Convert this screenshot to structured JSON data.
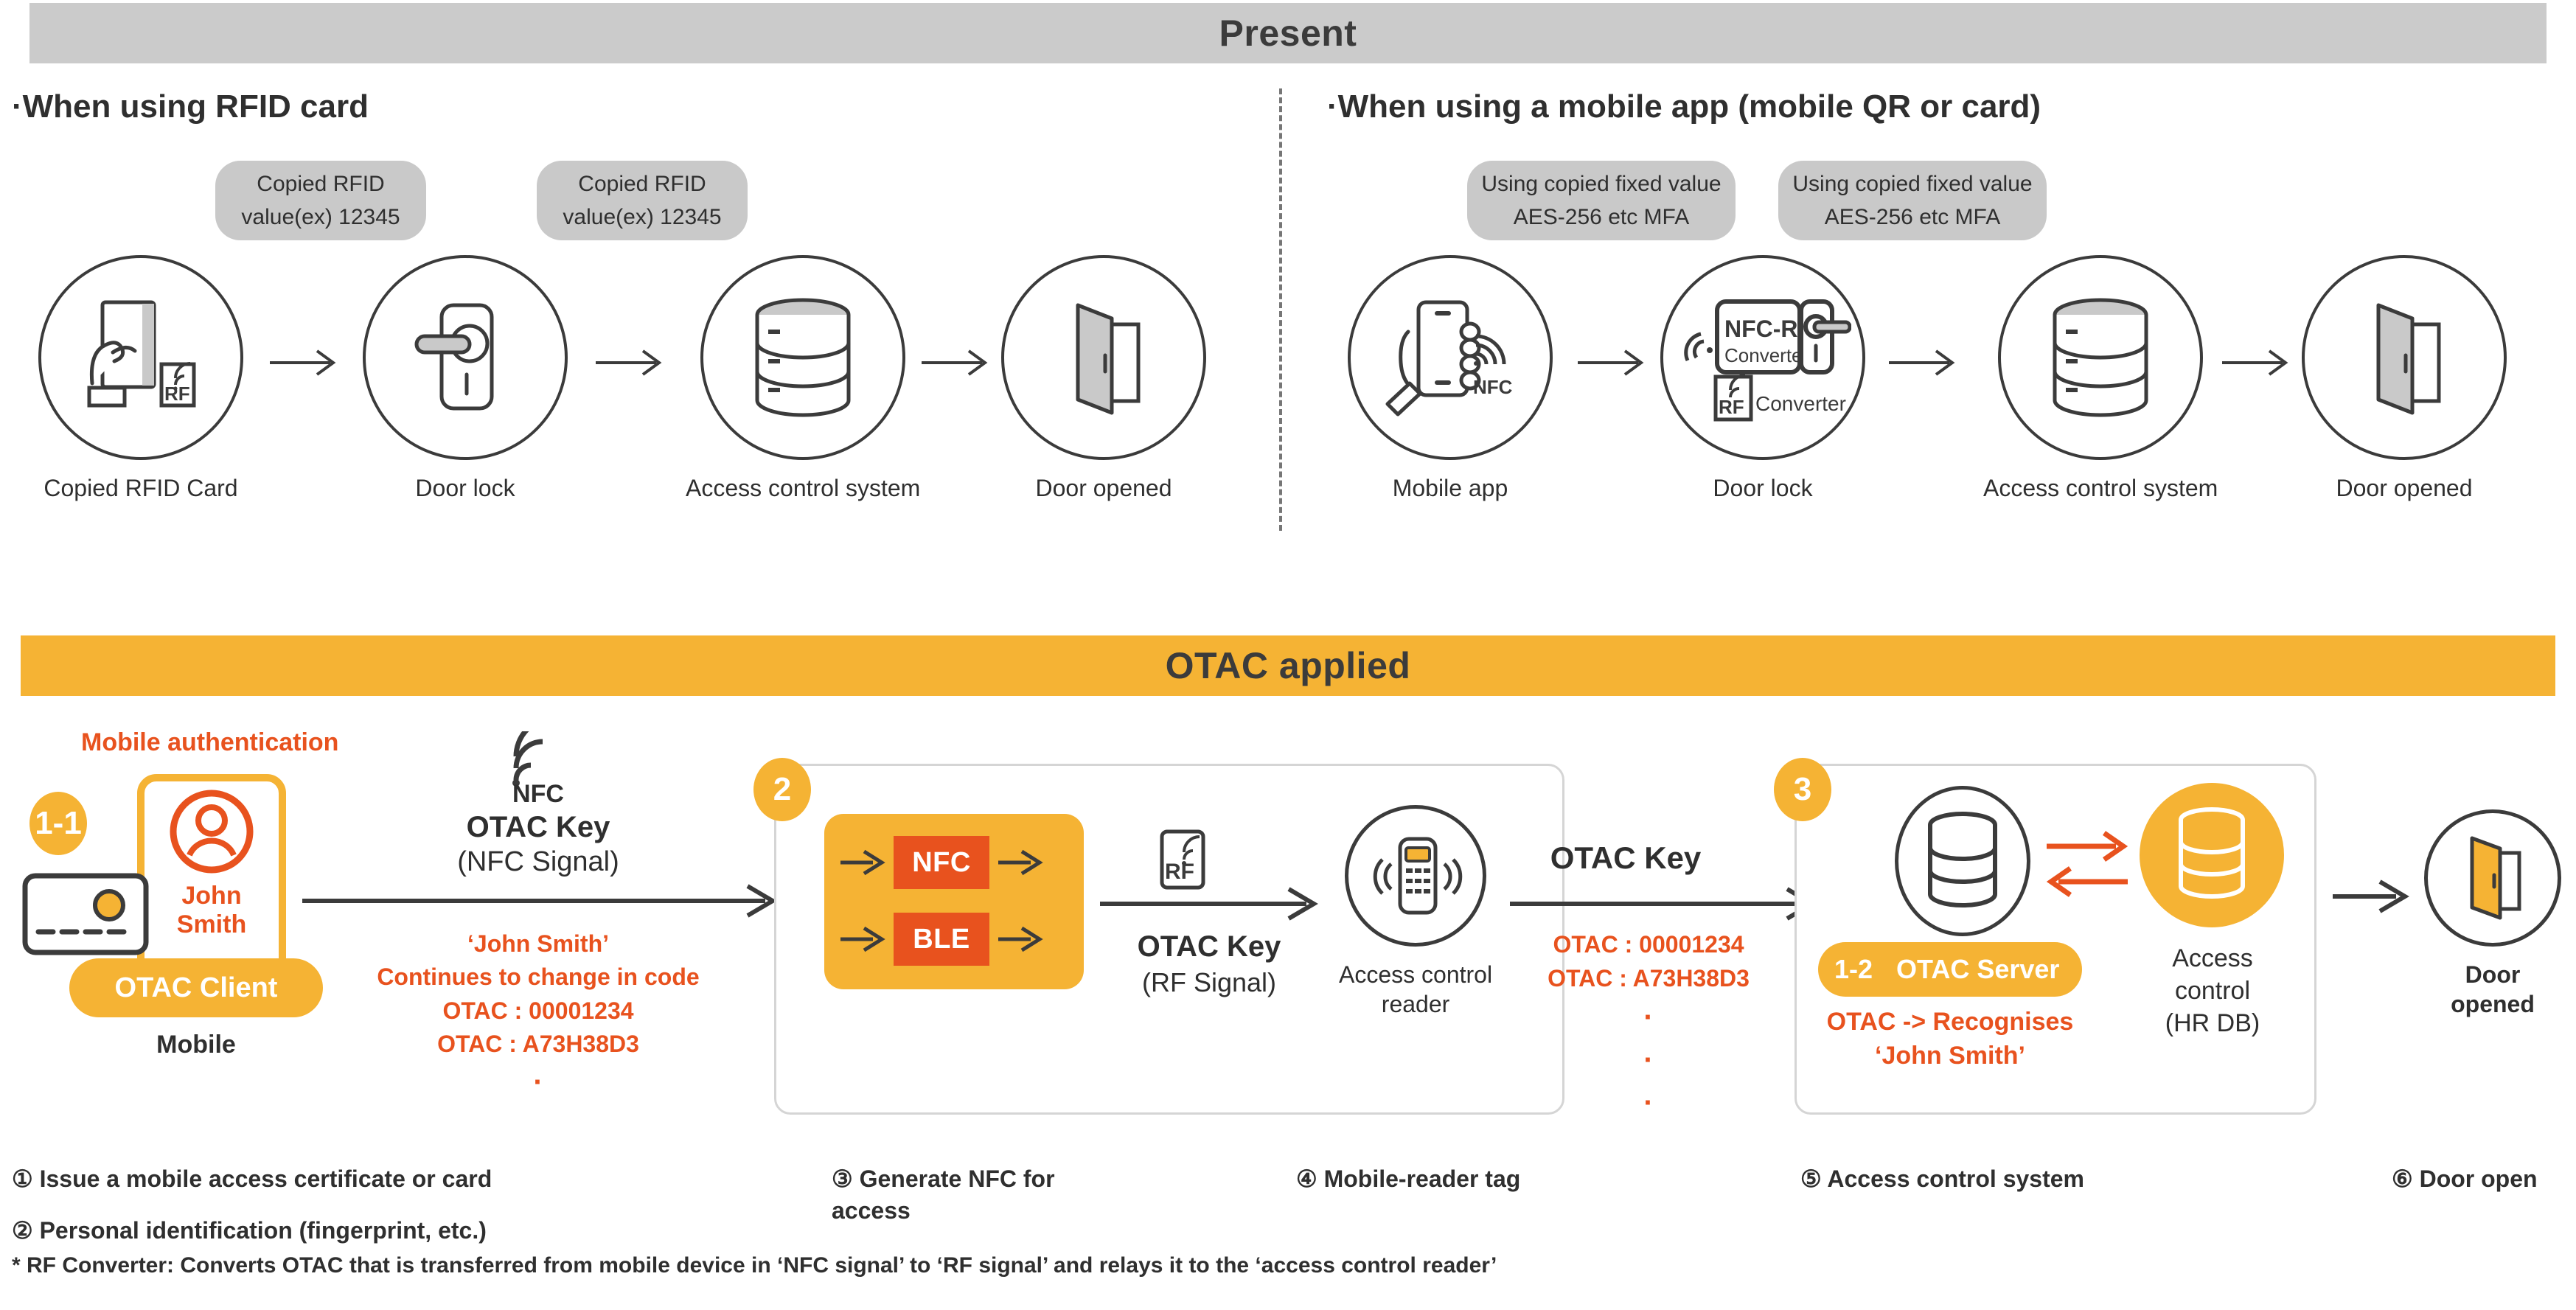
{
  "banners": {
    "present": "Present",
    "otac": "OTAC applied"
  },
  "present": {
    "left_subhead": "·When using RFID card",
    "right_subhead": "·When using a mobile app (mobile QR or card)",
    "callouts_left": [
      {
        "line1": "Copied RFID",
        "line2": "value(ex) 12345"
      },
      {
        "line1": "Copied RFID",
        "line2": "value(ex) 12345"
      }
    ],
    "callouts_right": [
      {
        "line1": "Using copied fixed value",
        "line2": "AES-256 etc MFA"
      },
      {
        "line1": "Using copied fixed value",
        "line2": "AES-256 etc MFA"
      }
    ],
    "nodes_left": [
      {
        "label": "Copied RFID Card",
        "icon": "hand-holding-rfid-card-icon"
      },
      {
        "label": "Door lock",
        "icon": "door-handle-lock-icon"
      },
      {
        "label": "Access control system",
        "icon": "database-cylinder-icon"
      },
      {
        "label": "Door opened",
        "icon": "open-door-icon"
      }
    ],
    "nodes_right": [
      {
        "label": "Mobile app",
        "icon": "hand-holding-phone-nfc-icon"
      },
      {
        "label": "Door lock",
        "icon": "nfc-rf-converter-lock-icon"
      },
      {
        "label": "Access control system",
        "icon": "database-cylinder-icon"
      },
      {
        "label": "Door opened",
        "icon": "open-door-icon"
      }
    ],
    "rf_badge": "RF",
    "nfc_label": "NFC",
    "converter": {
      "title": "NFC-RF",
      "subtitle": "Converter",
      "rf_badge": "RF",
      "rf_caption": "Converter"
    }
  },
  "otac": {
    "mobile_auth_label": "Mobile authentication",
    "badge_1_1": "1-1",
    "person_name_line1": "John",
    "person_name_line2": "Smith",
    "otac_client_label": "OTAC Client",
    "mobile_label": "Mobile",
    "nfc_label": "NFC",
    "otac_key_title_1": "OTAC Key",
    "otac_key_sub_1": "(NFC Signal)",
    "flow1_notes": [
      "‘John Smith’",
      "Continues to change in code",
      "OTAC : 00001234",
      "OTAC : A73H38D3",
      "·"
    ],
    "badge_2": "2",
    "chips": [
      "NFC",
      "BLE"
    ],
    "rf_badge": "RF",
    "otac_key_title_2": "OTAC Key",
    "otac_key_sub_2": "(RF Signal)",
    "reader_label": "Access control\nreader",
    "otac_key_title_3": "OTAC Key",
    "flow3_notes": [
      "OTAC : 00001234",
      "OTAC : A73H38D3",
      "·",
      "·",
      "·"
    ],
    "badge_3": "3",
    "badge_1_2": "1-2",
    "otac_server_label": "OTAC Server",
    "recognises_line1": "OTAC -> Recognises",
    "recognises_line2": "‘John Smith’",
    "access_control_label": "Access\ncontrol\n(HR DB)",
    "door_opened_label": "Door\nopened"
  },
  "captions": [
    {
      "text": "① Issue a mobile access certificate or card"
    },
    {
      "text": "② Personal identification (fingerprint, etc.)"
    },
    {
      "text": "③ Generate NFC for\n      access"
    },
    {
      "text": "④ Mobile-reader tag"
    },
    {
      "text": "⑤ Access control system"
    },
    {
      "text": "⑥ Door open"
    }
  ],
  "footnote": "* RF Converter: Converts OTAC that is transferred from mobile device in ‘NFC signal’ to ‘RF signal’ and relays it to the ‘access control reader’",
  "colors": {
    "grey_banner": "#cbcbcb",
    "yellow": "#f5b334",
    "orange": "#e8521e",
    "dark": "#3b3b3b",
    "callout_grey": "#c9c9c9"
  }
}
